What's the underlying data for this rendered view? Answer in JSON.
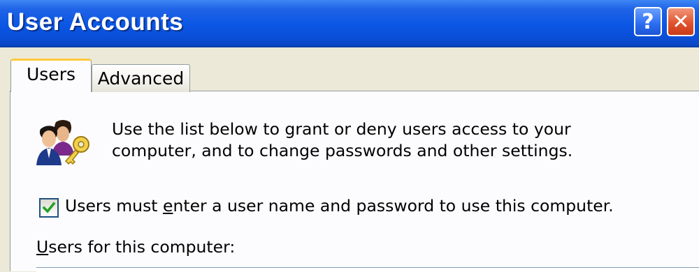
{
  "window": {
    "title": "User Accounts",
    "help_label": "?",
    "close_label": "✕"
  },
  "tabs": [
    {
      "label": "Users",
      "selected": true
    },
    {
      "label": "Advanced",
      "selected": false
    }
  ],
  "users_tab": {
    "icon": "users-keys-icon",
    "description_line1": "Use the list below to grant or deny users access to your",
    "description_line2": "computer, and to change passwords and other settings.",
    "require_login": {
      "checked": true,
      "label_prefix": "Users must ",
      "label_accel": "e",
      "label_suffix": "nter a user name and password to use this computer."
    },
    "users_list_label_accel": "U",
    "users_list_label_rest": "sers for this computer:"
  }
}
